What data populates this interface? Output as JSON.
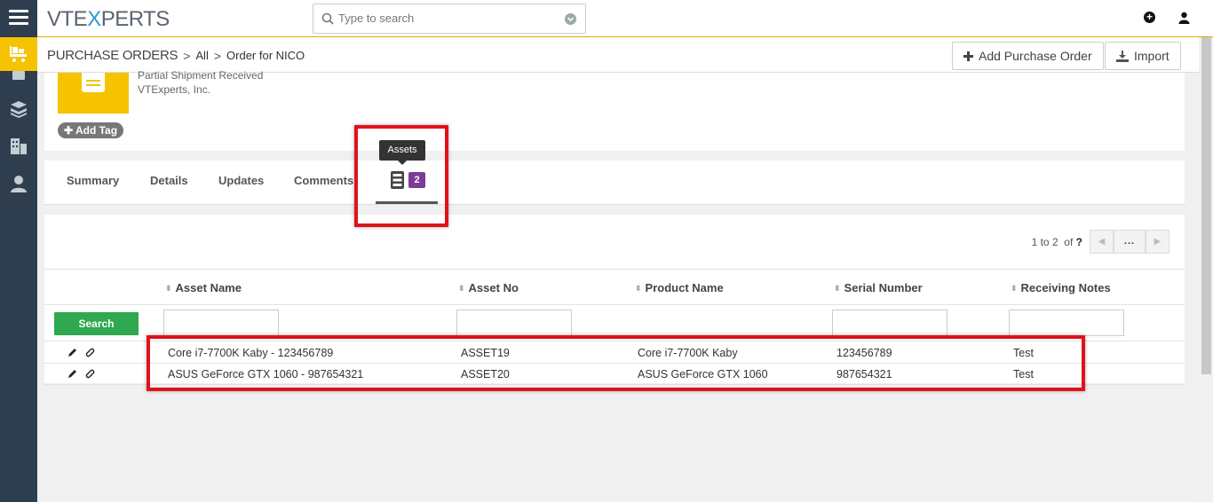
{
  "app": {
    "logo_pre": "VTE",
    "logo_x": "X",
    "logo_post": "PERTS"
  },
  "search": {
    "placeholder": "Type to search"
  },
  "header": {
    "module": "PURCHASE ORDERS",
    "crumb_all": "All",
    "crumb_record": "Order for NICO",
    "sep": ">",
    "add_label": "Add Purchase Order",
    "import_label": "Import"
  },
  "record": {
    "status": "Partial Shipment Received",
    "org": "VTExperts, Inc.",
    "add_tag": "Add Tag"
  },
  "tabs": {
    "summary": "Summary",
    "details": "Details",
    "updates": "Updates",
    "comments": "Comments",
    "assets_tooltip": "Assets",
    "assets_count": "2"
  },
  "pager": {
    "range": "1 to 2",
    "of_label": "of",
    "total": "?",
    "more": "..."
  },
  "table": {
    "search_button": "Search",
    "columns": [
      "Asset Name",
      "Asset No",
      "Product Name",
      "Serial Number",
      "Receiving Notes"
    ],
    "rows": [
      {
        "asset_name": "Core i7-7700K Kaby - 123456789",
        "asset_no": "ASSET19",
        "product": "Core i7-7700K Kaby",
        "serial": "123456789",
        "notes": "Test"
      },
      {
        "asset_name": "ASUS GeForce GTX 1060 - 987654321",
        "asset_no": "ASSET20",
        "product": "ASUS GeForce GTX 1060",
        "serial": "987654321",
        "notes": "Test"
      }
    ]
  },
  "colors": {
    "accent": "#f5c300",
    "rail": "#2f3e4e",
    "badge": "#7d3c98",
    "search_btn": "#2fa84f",
    "highlight": "#e0121b"
  }
}
